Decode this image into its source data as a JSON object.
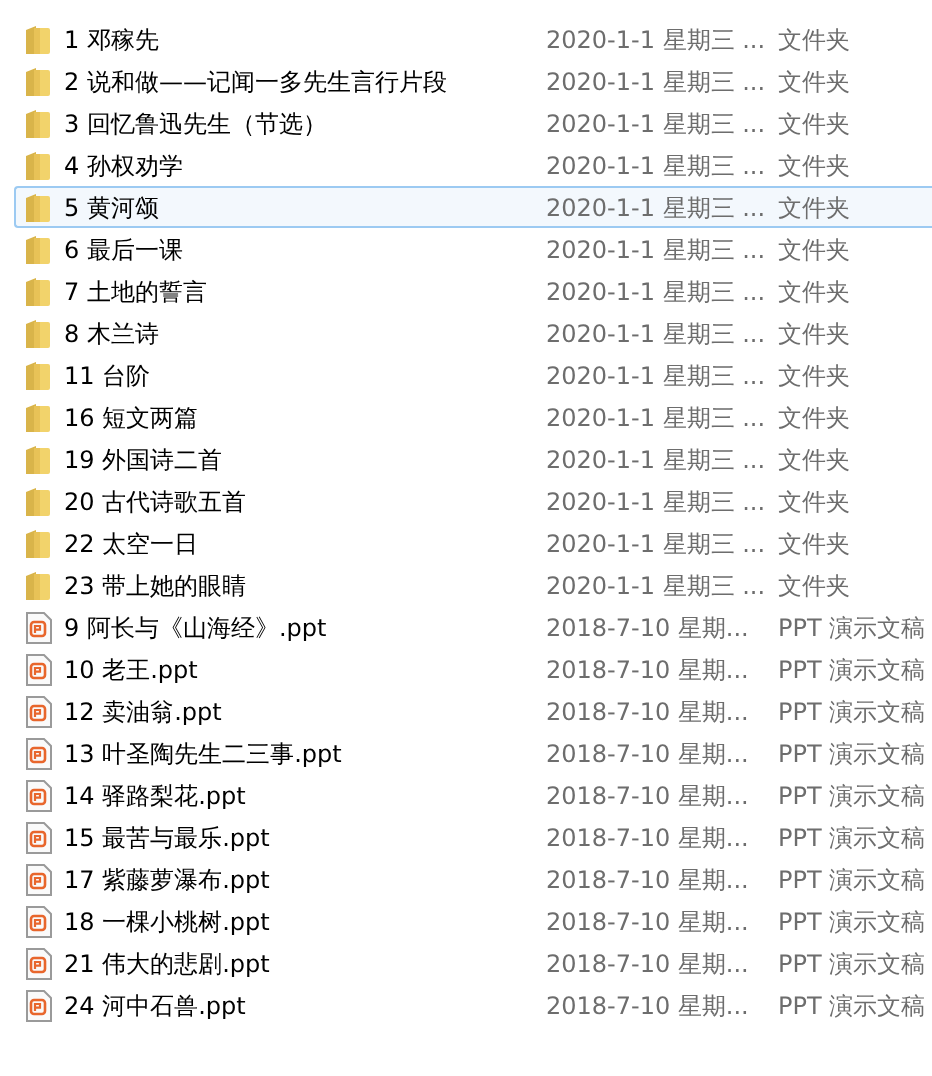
{
  "files": [
    {
      "kind": "folder",
      "name": "1 邓稼先",
      "date": "2020-1-1 星期三 ...",
      "type": "文件夹",
      "selected": false
    },
    {
      "kind": "folder",
      "name": "2 说和做——记闻一多先生言行片段",
      "date": "2020-1-1 星期三 ...",
      "type": "文件夹",
      "selected": false
    },
    {
      "kind": "folder",
      "name": "3 回忆鲁迅先生（节选）",
      "date": "2020-1-1 星期三 ...",
      "type": "文件夹",
      "selected": false
    },
    {
      "kind": "folder",
      "name": "4 孙权劝学",
      "date": "2020-1-1 星期三 ...",
      "type": "文件夹",
      "selected": false
    },
    {
      "kind": "folder",
      "name": "5 黄河颂",
      "date": "2020-1-1 星期三 ...",
      "type": "文件夹",
      "selected": true
    },
    {
      "kind": "folder",
      "name": "6 最后一课",
      "date": "2020-1-1 星期三 ...",
      "type": "文件夹",
      "selected": false
    },
    {
      "kind": "folder",
      "name": "7 土地的誓言",
      "date": "2020-1-1 星期三 ...",
      "type": "文件夹",
      "selected": false
    },
    {
      "kind": "folder",
      "name": "8 木兰诗",
      "date": "2020-1-1 星期三 ...",
      "type": "文件夹",
      "selected": false
    },
    {
      "kind": "folder",
      "name": "11 台阶",
      "date": "2020-1-1 星期三 ...",
      "type": "文件夹",
      "selected": false
    },
    {
      "kind": "folder",
      "name": "16 短文两篇",
      "date": "2020-1-1 星期三 ...",
      "type": "文件夹",
      "selected": false
    },
    {
      "kind": "folder",
      "name": "19 外国诗二首",
      "date": "2020-1-1 星期三 ...",
      "type": "文件夹",
      "selected": false
    },
    {
      "kind": "folder",
      "name": "20 古代诗歌五首",
      "date": "2020-1-1 星期三 ...",
      "type": "文件夹",
      "selected": false
    },
    {
      "kind": "folder",
      "name": "22 太空一日",
      "date": "2020-1-1 星期三 ...",
      "type": "文件夹",
      "selected": false
    },
    {
      "kind": "folder",
      "name": "23 带上她的眼睛",
      "date": "2020-1-1 星期三 ...",
      "type": "文件夹",
      "selected": false
    },
    {
      "kind": "ppt",
      "name": "9 阿长与《山海经》.ppt",
      "date": "2018-7-10 星期...",
      "type": "PPT 演示文稿",
      "selected": false
    },
    {
      "kind": "ppt",
      "name": "10 老王.ppt",
      "date": "2018-7-10 星期...",
      "type": "PPT 演示文稿",
      "selected": false
    },
    {
      "kind": "ppt",
      "name": "12 卖油翁.ppt",
      "date": "2018-7-10 星期...",
      "type": "PPT 演示文稿",
      "selected": false
    },
    {
      "kind": "ppt",
      "name": "13 叶圣陶先生二三事.ppt",
      "date": "2018-7-10 星期...",
      "type": "PPT 演示文稿",
      "selected": false
    },
    {
      "kind": "ppt",
      "name": "14 驿路梨花.ppt",
      "date": "2018-7-10 星期...",
      "type": "PPT 演示文稿",
      "selected": false
    },
    {
      "kind": "ppt",
      "name": "15 最苦与最乐.ppt",
      "date": "2018-7-10 星期...",
      "type": "PPT 演示文稿",
      "selected": false
    },
    {
      "kind": "ppt",
      "name": "17 紫藤萝瀑布.ppt",
      "date": "2018-7-10 星期...",
      "type": "PPT 演示文稿",
      "selected": false
    },
    {
      "kind": "ppt",
      "name": "18 一棵小桃树.ppt",
      "date": "2018-7-10 星期...",
      "type": "PPT 演示文稿",
      "selected": false
    },
    {
      "kind": "ppt",
      "name": "21 伟大的悲剧.ppt",
      "date": "2018-7-10 星期...",
      "type": "PPT 演示文稿",
      "selected": false
    },
    {
      "kind": "ppt",
      "name": "24 河中石兽.ppt",
      "date": "2018-7-10 星期...",
      "type": "PPT 演示文稿",
      "selected": false
    }
  ]
}
